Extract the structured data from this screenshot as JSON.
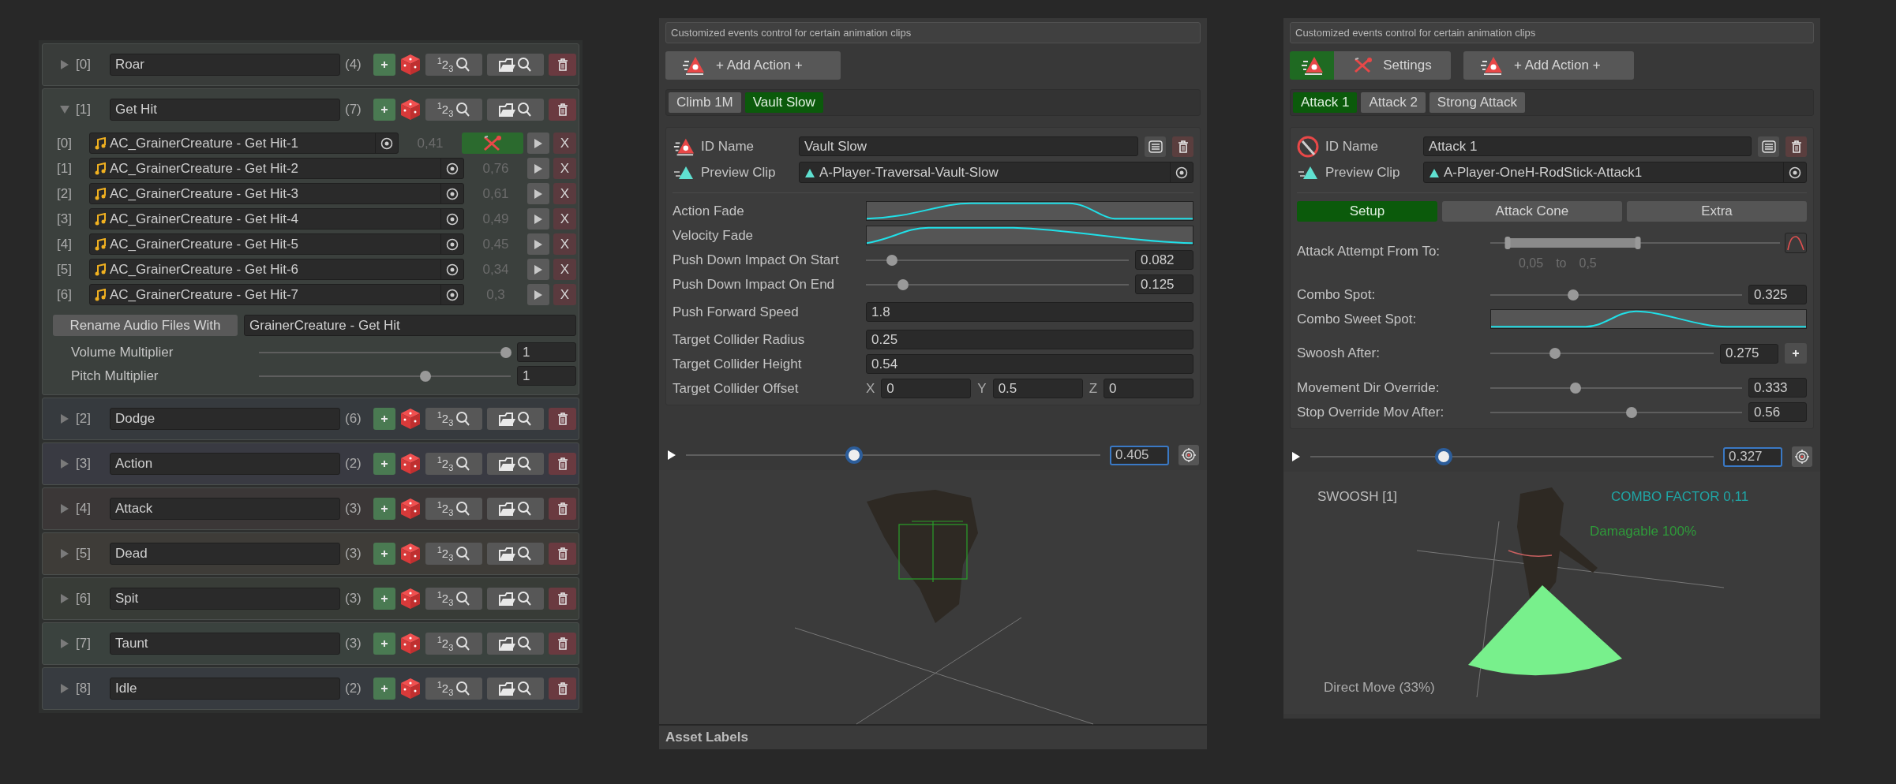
{
  "left": {
    "groups": [
      {
        "index": "[0]",
        "name": "Roar",
        "count": "(4)",
        "number_label": "$^{1}$2$_{3}$",
        "expanded": false,
        "color": "#393c3a"
      },
      {
        "index": "[1]",
        "name": "Get Hit",
        "count": "(7)",
        "number_label": "$^{1}$2$_{3}$",
        "expanded": true,
        "color": "#3b403d",
        "clips": [
          {
            "index": "[0]",
            "name": "AC_GrainerCreature - Get Hit-1",
            "value": "0,41",
            "editing": true,
            "remove": "X"
          },
          {
            "index": "[1]",
            "name": "AC_GrainerCreature - Get Hit-2",
            "value": "0,76",
            "editing": false,
            "remove": "X"
          },
          {
            "index": "[2]",
            "name": "AC_GrainerCreature - Get Hit-3",
            "value": "0,61",
            "editing": false,
            "remove": "X"
          },
          {
            "index": "[3]",
            "name": "AC_GrainerCreature - Get Hit-4",
            "value": "0,49",
            "editing": false,
            "remove": "X"
          },
          {
            "index": "[4]",
            "name": "AC_GrainerCreature - Get Hit-5",
            "value": "0,45",
            "editing": false,
            "remove": "X"
          },
          {
            "index": "[5]",
            "name": "AC_GrainerCreature - Get Hit-6",
            "value": "0,34",
            "editing": false,
            "remove": "X"
          },
          {
            "index": "[6]",
            "name": "AC_GrainerCreature - Get Hit-7",
            "value": "0,3",
            "editing": false,
            "remove": "X"
          }
        ],
        "rename_button": "Rename Audio Files With",
        "rename_value": "GrainerCreature - Get Hit",
        "multipliers": [
          {
            "label": "Volume Multiplier",
            "level": 0.98,
            "value": "1"
          },
          {
            "label": "Pitch Multiplier",
            "level": 0.66,
            "value": "1"
          }
        ]
      },
      {
        "index": "[2]",
        "name": "Dodge",
        "count": "(6)",
        "number_label": "$^{1}$2$_{3}$",
        "expanded": false,
        "color": "#363a3e"
      },
      {
        "index": "[3]",
        "name": "Action",
        "count": "(2)",
        "number_label": "$^{1}$2$_{3}$",
        "expanded": false,
        "color": "#393a42"
      },
      {
        "index": "[4]",
        "name": "Attack",
        "count": "(3)",
        "number_label": "$^{1}$2$_{3}$",
        "expanded": false,
        "color": "#3b3737"
      },
      {
        "index": "[5]",
        "name": "Dead",
        "count": "(3)",
        "number_label": "$^{1}$2$_{3}$",
        "expanded": false,
        "color": "#3e3c38"
      },
      {
        "index": "[6]",
        "name": "Spit",
        "count": "(3)",
        "number_label": "$^{1}$2$_{3}$",
        "expanded": false,
        "color": "#383c37"
      },
      {
        "index": "[7]",
        "name": "Taunt",
        "count": "(3)",
        "number_label": "$^{1}$2$_{3}$",
        "expanded": false,
        "color": "#3a423e"
      },
      {
        "index": "[8]",
        "name": "Idle",
        "count": "(2)",
        "number_label": "$^{1}$2$_{3}$",
        "expanded": false,
        "color": "#373b40"
      }
    ]
  },
  "inspectors": [
    {
      "kind": "action",
      "description": "Customized events control for certain animation clips",
      "toolbar": [
        {
          "kind": "add",
          "label": "+ Add Action +"
        }
      ],
      "tabs": [
        {
          "label": "Climb 1M",
          "selected": false
        },
        {
          "label": "Vault Slow",
          "selected": true
        }
      ],
      "id_label": "ID Name",
      "id_value": "Vault Slow",
      "clip_label": "Preview Clip",
      "clip_value": "A-Player-Traversal-Vault-Slow",
      "sections": [
        [
          {
            "kind": "curve_plateau",
            "label": "Action Fade"
          },
          {
            "kind": "curve_rise_fall",
            "label": "Velocity Fade"
          },
          {
            "kind": "slider",
            "label": "Push Down Impact On Start",
            "level": 0.1,
            "value": "0.082"
          },
          {
            "kind": "slider",
            "label": "Push Down Impact On End",
            "level": 0.14,
            "value": "0.125"
          }
        ],
        [
          {
            "kind": "field",
            "label": "Push Forward Speed",
            "value": "1.8"
          }
        ],
        [
          {
            "kind": "field",
            "label": "Target Collider Radius",
            "value": "0.25"
          },
          {
            "kind": "field",
            "label": "Target Collider Height",
            "value": "0.54"
          },
          {
            "kind": "vector",
            "label": "Target Collider Offset",
            "components": [
              {
                "axis": "X",
                "value": "0"
              },
              {
                "axis": "Y",
                "value": "0.5"
              },
              {
                "axis": "Z",
                "value": "0"
              }
            ]
          }
        ]
      ],
      "timeline": {
        "level": 0.405,
        "value": "0.405"
      },
      "viewport": {
        "kind": "collider"
      },
      "footer": "Asset Labels"
    },
    {
      "kind": "attack",
      "description": "Customized events control for certain animation clips",
      "toolbar": [
        {
          "kind": "mode",
          "selected": true
        },
        {
          "kind": "settings",
          "label": "Settings"
        },
        {
          "kind": "add",
          "label": "+ Add Action +"
        }
      ],
      "tabs": [
        {
          "label": "Attack 1",
          "selected": true
        },
        {
          "label": "Attack 2",
          "selected": false
        },
        {
          "label": "Strong Attack",
          "selected": false
        }
      ],
      "id_label": "ID Name",
      "id_value": "Attack 1",
      "clip_label": "Preview Clip",
      "clip_value": "A-Player-OneH-RodStick-Attack1",
      "subtabs": [
        {
          "label": "Setup",
          "selected": true
        },
        {
          "label": "Attack Cone",
          "selected": false
        },
        {
          "label": "Extra",
          "selected": false
        }
      ],
      "sections": [
        [
          {
            "kind": "range",
            "label": "Attack Attempt From To:",
            "from": {
              "level": 0.06,
              "text": "0,05"
            },
            "joiner": "to",
            "to": {
              "level": 0.51,
              "text": "0,5"
            }
          }
        ],
        [
          {
            "kind": "slider",
            "label": "Combo Spot:",
            "level": 0.33,
            "value": "0.325"
          },
          {
            "kind": "curve_bump",
            "label": "Combo Sweet Spot:"
          }
        ],
        [
          {
            "kind": "slider_add",
            "label": "Swoosh After:",
            "level": 0.29,
            "value": "0.275"
          }
        ],
        [
          {
            "kind": "slider",
            "label": "Movement Dir Override:",
            "level": 0.34,
            "value": "0.333"
          },
          {
            "kind": "slider",
            "label": "Stop Override Mov After:",
            "level": 0.56,
            "value": "0.56"
          }
        ]
      ],
      "timeline": {
        "level": 0.33,
        "value": "0.327"
      },
      "viewport": {
        "kind": "cone",
        "labels": [
          {
            "kind": "swoosh",
            "text": "SWOOSH [1]",
            "color": "#bdbdbd"
          },
          {
            "kind": "combo",
            "text": "COMBO FACTOR 0,11",
            "color": "#1fa6a6"
          },
          {
            "kind": "damage",
            "text": "Damagable 100%",
            "color": "#2f9a3a"
          },
          {
            "kind": "move",
            "text": "Direct Move (33%)",
            "color": "#aaaaaa"
          }
        ]
      }
    }
  ]
}
